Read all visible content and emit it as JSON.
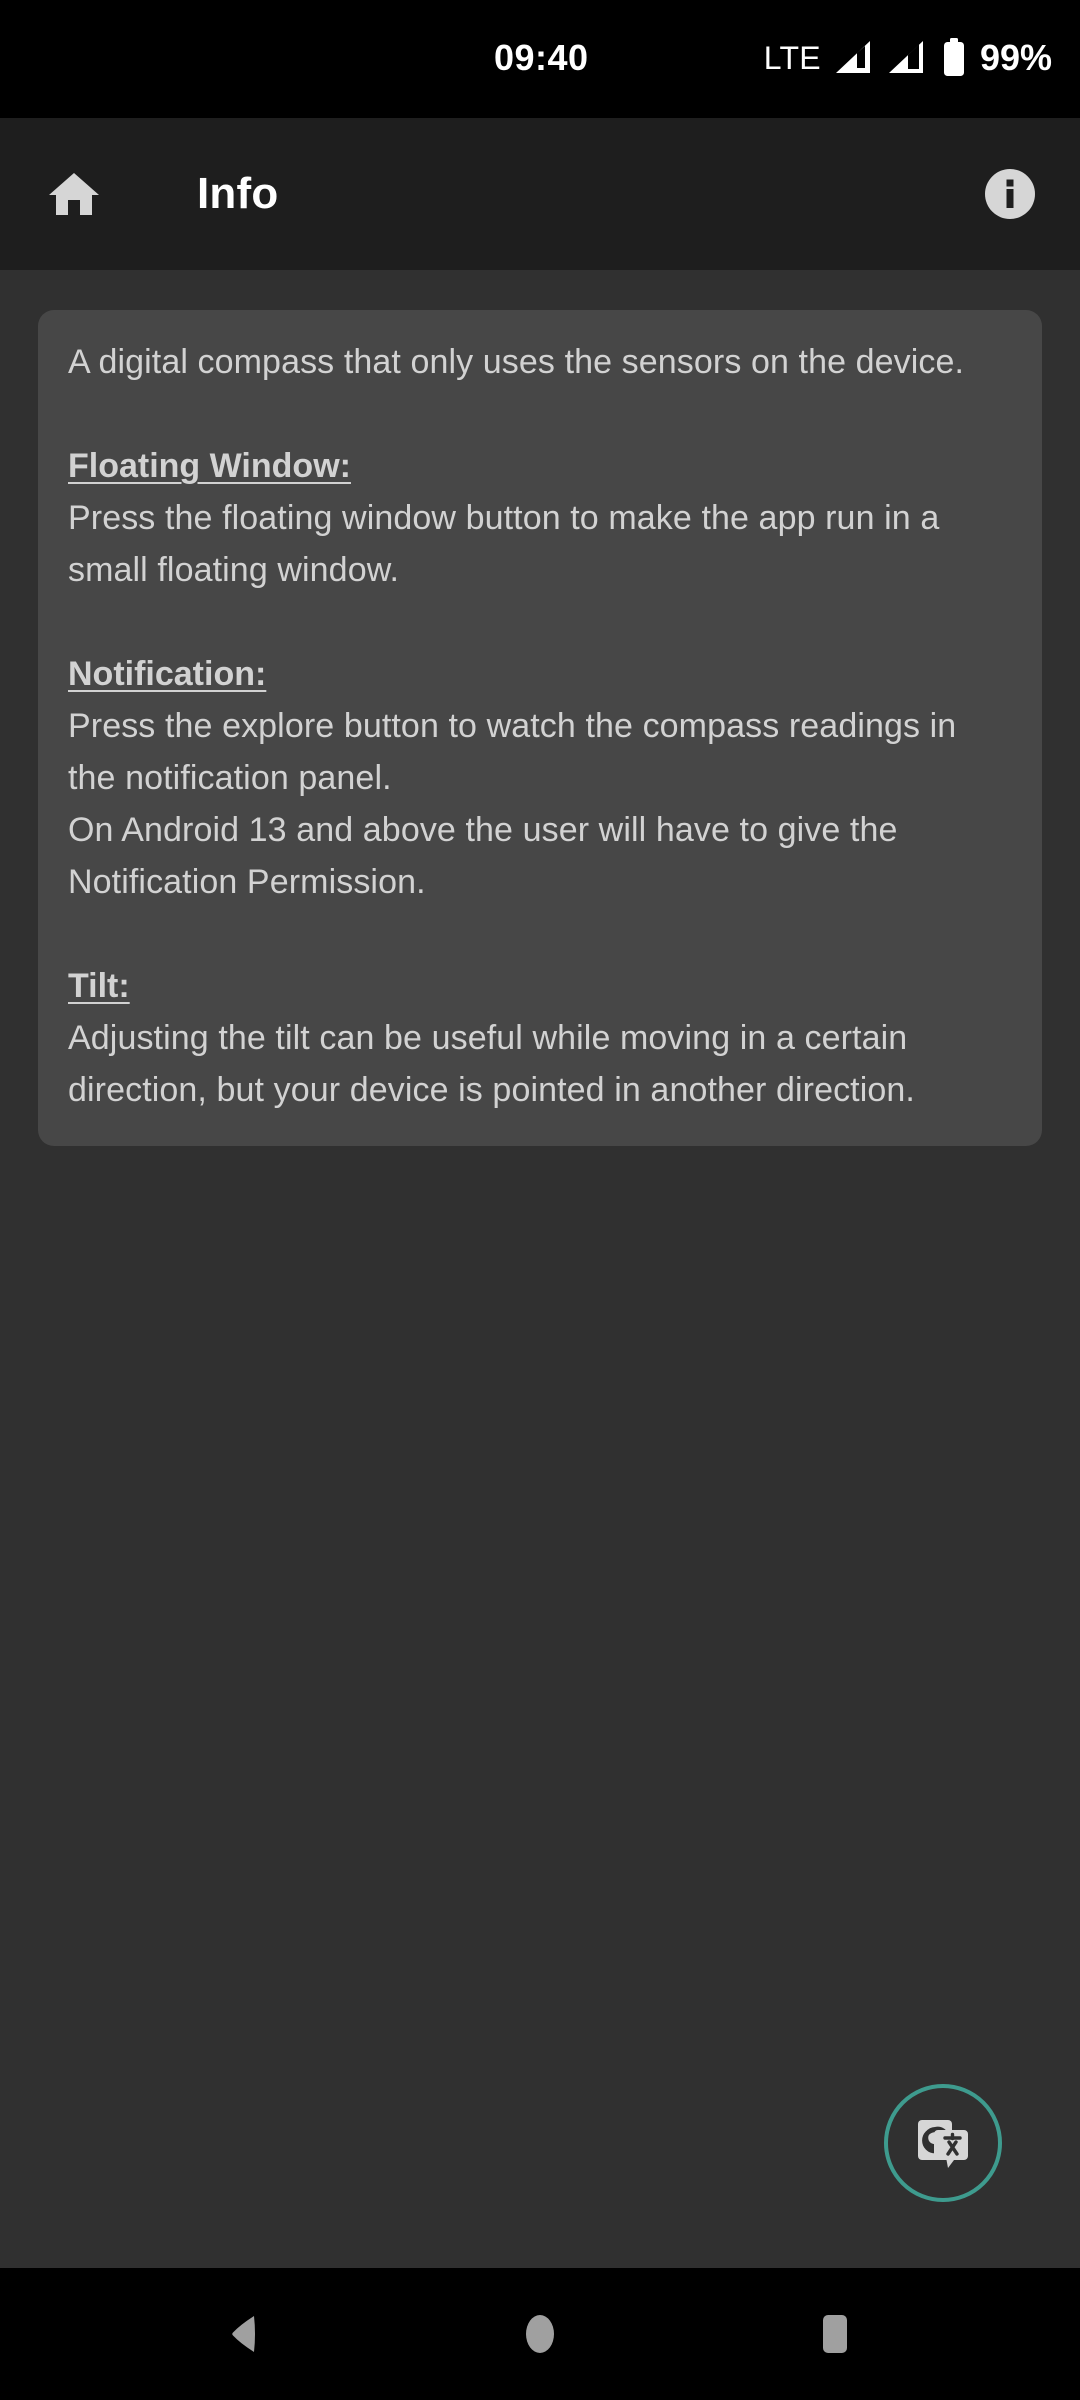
{
  "status_bar": {
    "clock": "09:40",
    "network_label": "LTE",
    "battery_percent": "99%",
    "icons": {
      "signal_primary": "signal-bar-icon",
      "signal_secondary": "signal-bar-icon",
      "battery": "battery-full-icon"
    }
  },
  "app_bar": {
    "home_icon": "home-icon",
    "title": "Info",
    "info_icon": "info-circle-icon"
  },
  "info_card": {
    "intro": "A digital compass that only uses the sensors on the device.",
    "sections": [
      {
        "heading": "Floating Window:",
        "body": "Press the floating window button to make the app run in a small floating window."
      },
      {
        "heading": "Notification:",
        "body": "Press the explore button to watch the compass readings in the notification panel.\nOn Android 13 and above the user will have to give the Notification Permission."
      },
      {
        "heading": "Tilt:",
        "body": "Adjusting the tilt can be useful while moving in a certain direction, but your device is pointed in another direction."
      }
    ]
  },
  "translate_bubble": {
    "icon": "google-translate-icon",
    "ring_color": "#3e9b8e"
  },
  "nav_bar": {
    "back": "back-triangle-icon",
    "home": "home-circle-icon",
    "recents": "recents-square-icon"
  },
  "colors": {
    "status_bar_bg": "#000000",
    "app_bar_bg": "#1e1e1e",
    "content_bg": "#303030",
    "card_bg": "#474747",
    "body_text": "#d2d2d2",
    "title_text": "#ffffff",
    "nav_glyph": "#a0a0a0"
  }
}
